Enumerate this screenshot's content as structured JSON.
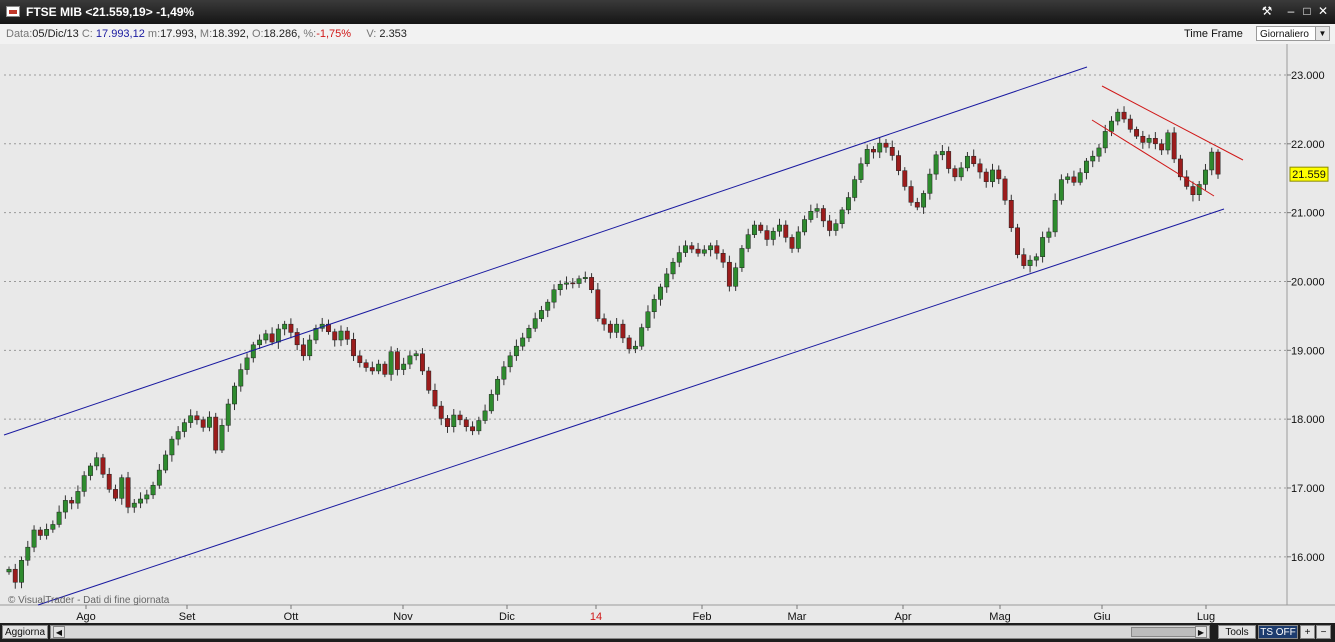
{
  "window": {
    "title": "FTSE MIB <21.559,19> -1,49%"
  },
  "infobar": {
    "data_label": "Data:",
    "data_value": "05/Dic/13",
    "c_label": "C:",
    "c_value": "17.993,12",
    "m_label": "m:",
    "m_value": "17.993",
    "M_label": "M:",
    "M_value": "18.392",
    "o_label": "O:",
    "o_value": "18.286",
    "pct_label": "%:",
    "pct_value": "-1,75%",
    "v_label": "V:",
    "v_value": "2.353",
    "timeframe_label": "Time Frame",
    "timeframe_value": "Giornaliero"
  },
  "bottombar": {
    "aggiorna": "Aggiorna",
    "tools": "Tools",
    "ts_off": "TS OFF"
  },
  "colors": {
    "bull": "#2e8b2e",
    "bear": "#9b1c1c",
    "channel": "#1a1aa0",
    "short_channel": "#d01818",
    "last_price_bg": "#ffff00"
  },
  "chart_data": {
    "type": "candlestick",
    "title": "",
    "watermark": "© VisualTrader - Dati di fine giornata",
    "last_price_label": "21.559",
    "y_ticks": [
      "16.000",
      "17.000",
      "18.000",
      "19.000",
      "20.000",
      "21.000",
      "22.000",
      "23.000"
    ],
    "y_tick_values": [
      16000,
      17000,
      18000,
      19000,
      20000,
      21000,
      22000,
      23000
    ],
    "ylim": [
      15300,
      23450
    ],
    "x_labels": [
      "Ago",
      "Set",
      "Ott",
      "Nov",
      "Dic",
      "14",
      "Feb",
      "Mar",
      "Apr",
      "Mag",
      "Giu",
      "Lug"
    ],
    "x_label_highlight": "14",
    "grid": "horizontal dotted",
    "closes": [
      15820,
      15630,
      15950,
      16140,
      16390,
      16310,
      16400,
      16470,
      16650,
      16820,
      16780,
      16950,
      17180,
      17320,
      17440,
      17200,
      16980,
      16850,
      17150,
      16720,
      16780,
      16840,
      16900,
      17040,
      17260,
      17480,
      17710,
      17820,
      17950,
      18050,
      17990,
      17880,
      18030,
      17550,
      17910,
      18220,
      18480,
      18720,
      18890,
      19080,
      19150,
      19240,
      19120,
      19310,
      19380,
      19260,
      19080,
      18920,
      19150,
      19320,
      19380,
      19270,
      19150,
      19280,
      19160,
      18920,
      18820,
      18750,
      18700,
      18800,
      18650,
      18980,
      18720,
      18800,
      18920,
      18950,
      18700,
      18420,
      18190,
      18010,
      17890,
      18060,
      17990,
      17890,
      17830,
      17980,
      18120,
      18360,
      18580,
      18760,
      18920,
      19060,
      19180,
      19320,
      19460,
      19580,
      19700,
      19880,
      19960,
      19980,
      19970,
      20040,
      20060,
      19880,
      19460,
      19380,
      19260,
      19380,
      19180,
      19020,
      19060,
      19330,
      19560,
      19740,
      19920,
      20110,
      20280,
      20420,
      20520,
      20470,
      20410,
      20460,
      20520,
      20410,
      20280,
      19930,
      20200,
      20480,
      20680,
      20820,
      20740,
      20610,
      20730,
      20820,
      20640,
      20480,
      20720,
      20900,
      21020,
      21060,
      20880,
      20740,
      20840,
      21040,
      21220,
      21480,
      21710,
      21920,
      21880,
      22010,
      21950,
      21830,
      21610,
      21380,
      21150,
      21080,
      21280,
      21560,
      21840,
      21890,
      21640,
      21520,
      21650,
      21820,
      21710,
      21590,
      21450,
      21620,
      21490,
      21180,
      20780,
      20390,
      20230,
      20310,
      20360,
      20640,
      20720,
      21180,
      21480,
      21520,
      21440,
      21580,
      21750,
      21820,
      21940,
      22180,
      22330,
      22460,
      22360,
      22210,
      22110,
      22020,
      22080,
      22000,
      21910,
      22160,
      21780,
      21520,
      21380,
      21260,
      21410,
      21620,
      21880,
      21559
    ]
  }
}
